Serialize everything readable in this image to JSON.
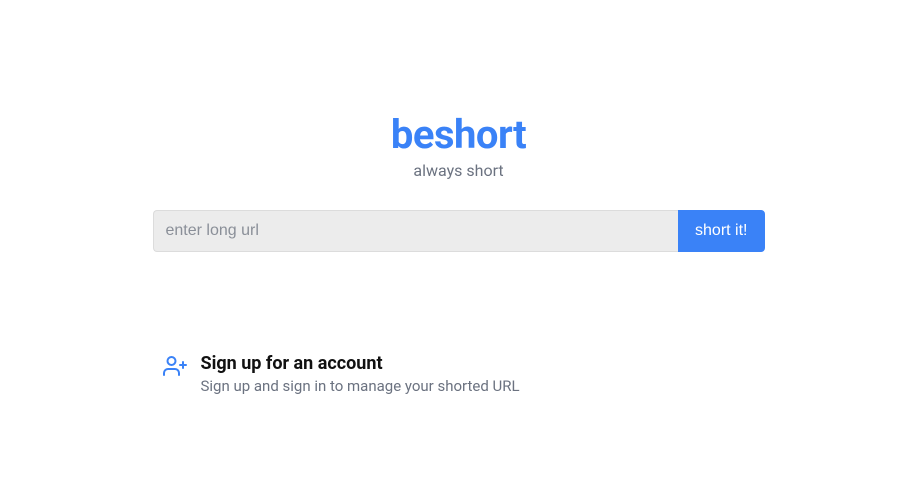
{
  "brand": {
    "title": "beshort",
    "tagline": "always short"
  },
  "form": {
    "placeholder": "enter long url",
    "button_label": "short it!"
  },
  "feature": {
    "title": "Sign up for an account",
    "description": "Sign up and sign in to manage your shorted URL"
  }
}
